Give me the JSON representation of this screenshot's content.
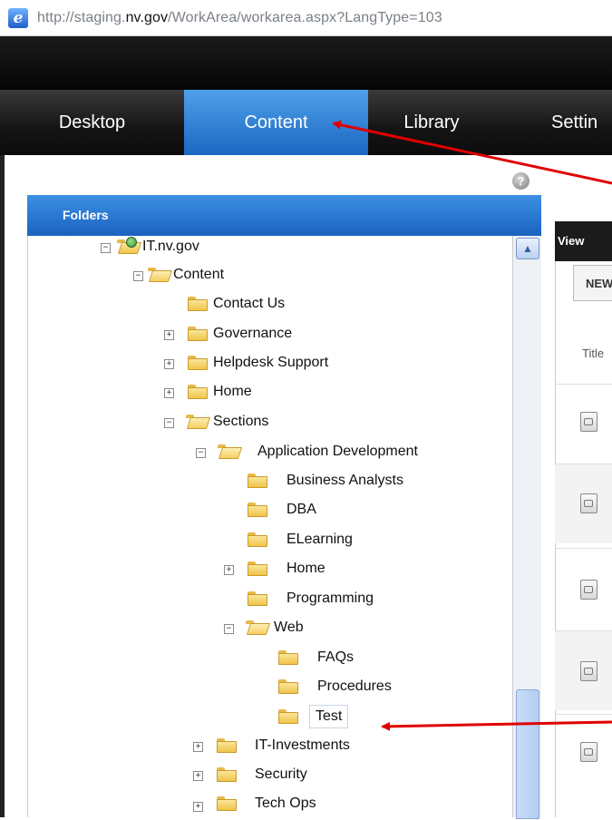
{
  "browser": {
    "url_prefix": "http://staging.",
    "url_domain": "nv.gov",
    "url_suffix": "/WorkArea/workarea.aspx?LangType=103"
  },
  "nav": {
    "tabs": [
      {
        "label": "Desktop",
        "active": false
      },
      {
        "label": "Content",
        "active": true
      },
      {
        "label": "Library",
        "active": false
      },
      {
        "label": "Settin",
        "active": false
      }
    ]
  },
  "help_icon": "question-icon",
  "folders_panel": {
    "title": "Folders",
    "tree": [
      {
        "label": "IT.nv.gov",
        "toggle": "−"
      },
      {
        "label": "Content",
        "toggle": "−"
      },
      {
        "label": "Contact Us",
        "toggle": ""
      },
      {
        "label": "Governance",
        "toggle": "+"
      },
      {
        "label": "Helpdesk Support",
        "toggle": "+"
      },
      {
        "label": "Home",
        "toggle": "+"
      },
      {
        "label": "Sections",
        "toggle": "−"
      },
      {
        "label": "Application Development",
        "toggle": "−"
      },
      {
        "label": "Business Analysts",
        "toggle": ""
      },
      {
        "label": "DBA",
        "toggle": ""
      },
      {
        "label": "ELearning",
        "toggle": ""
      },
      {
        "label": "Home",
        "toggle": "+"
      },
      {
        "label": "Programming",
        "toggle": ""
      },
      {
        "label": "Web",
        "toggle": "−"
      },
      {
        "label": "FAQs",
        "toggle": ""
      },
      {
        "label": "Procedures",
        "toggle": ""
      },
      {
        "label": "Test",
        "toggle": "",
        "selected": true
      },
      {
        "label": "IT-Investments",
        "toggle": "+"
      },
      {
        "label": "Security",
        "toggle": "+"
      },
      {
        "label": "Tech Ops",
        "toggle": "+"
      }
    ]
  },
  "right_panel": {
    "header": "View",
    "new_button": "NEW",
    "title_column": "Title"
  },
  "colors": {
    "active_tab": "#1a67c2",
    "annotation_arrow": "#e00000"
  }
}
